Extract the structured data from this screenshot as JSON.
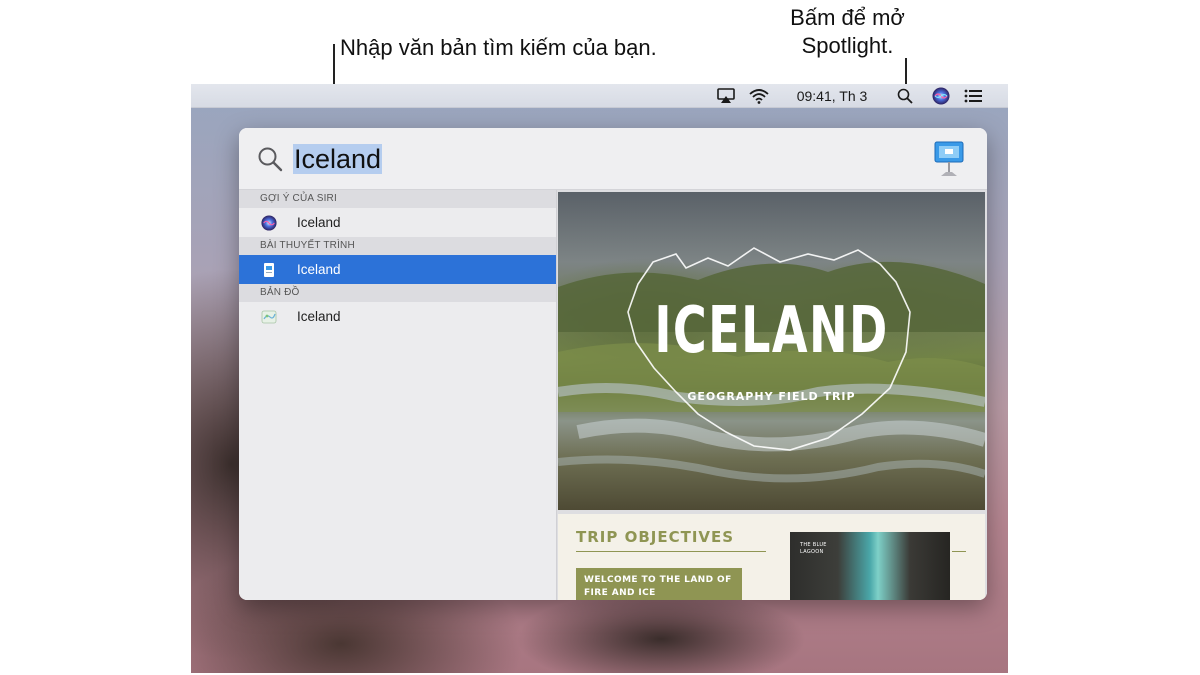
{
  "callouts": {
    "search_hint": "Nhập văn bản tìm kiếm của bạn.",
    "spotlight_hint_line1": "Bấm để mở",
    "spotlight_hint_line2": "Spotlight."
  },
  "menubar": {
    "clock": "09:41, Th 3",
    "icons": [
      "airplay-icon",
      "wifi-icon",
      "spotlight-search-icon",
      "siri-icon",
      "notification-list-icon"
    ]
  },
  "spotlight": {
    "query": "Iceland",
    "app_icon": "keynote-icon",
    "sections": [
      {
        "header": "GỢI Ý CỦA SIRI",
        "item": "Iceland",
        "icon": "siri-icon",
        "selected": false
      },
      {
        "header": "BÀI THUYẾT TRÌNH",
        "item": "Iceland",
        "icon": "keynote-doc-icon",
        "selected": true
      },
      {
        "header": "BẢN ĐỒ",
        "item": "Iceland",
        "icon": "maps-icon",
        "selected": false
      }
    ],
    "preview": {
      "slide1_title": "ICELAND",
      "slide1_subtitle": "GEOGRAPHY FIELD TRIP",
      "slide2_title": "TRIP OBJECTIVES",
      "slide2_box_line1": "WELCOME TO THE LAND OF",
      "slide2_box_line2": "FIRE AND ICE",
      "slide2_photo_line1": "THE BLUE",
      "slide2_photo_line2": "LAGOON"
    }
  },
  "colors": {
    "selection_blue": "#2c72d8",
    "query_highlight": "#b5cdef",
    "slide_olive": "#8f9553"
  }
}
